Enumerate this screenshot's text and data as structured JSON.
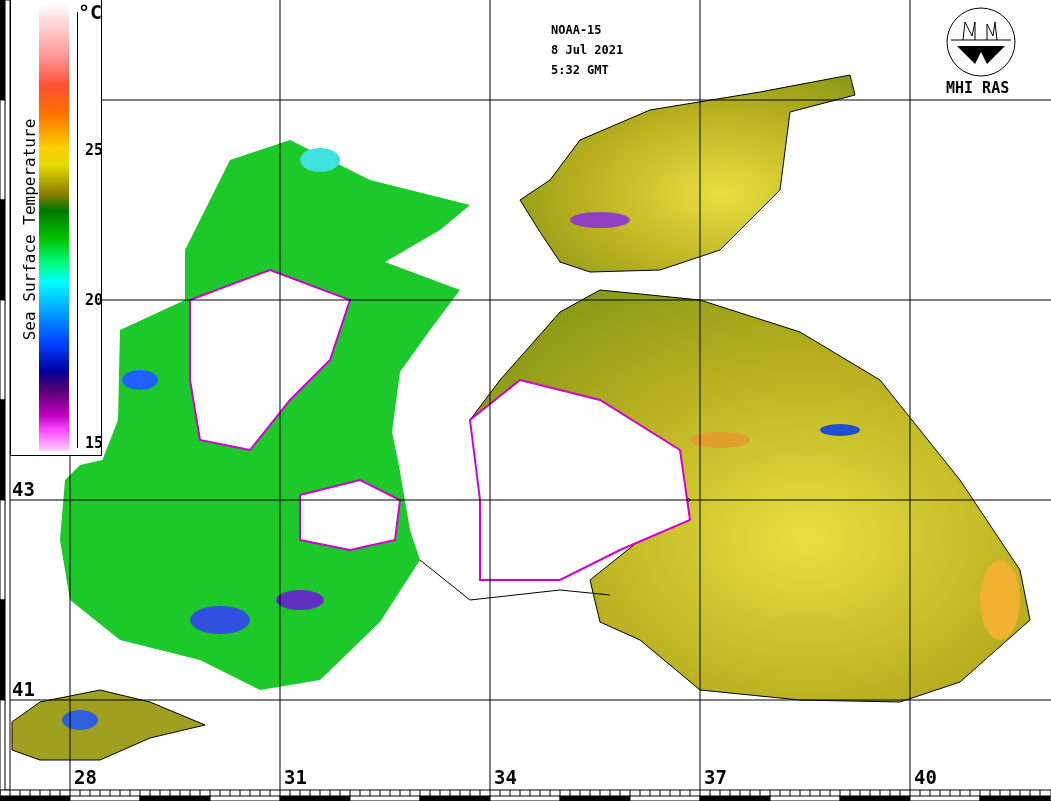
{
  "header": {
    "lines": [
      "NOAA-15",
      "8 Jul 2021",
      "5:32 GMT"
    ]
  },
  "logo": {
    "label": "MHI RAS"
  },
  "legend": {
    "title": "Sea Surface Temperature",
    "unit": "°C",
    "ticks": [
      "25",
      "20",
      "15"
    ]
  },
  "latitudes": [
    "43",
    "41"
  ],
  "longitudes": [
    "28",
    "31",
    "34",
    "37",
    "40"
  ]
}
